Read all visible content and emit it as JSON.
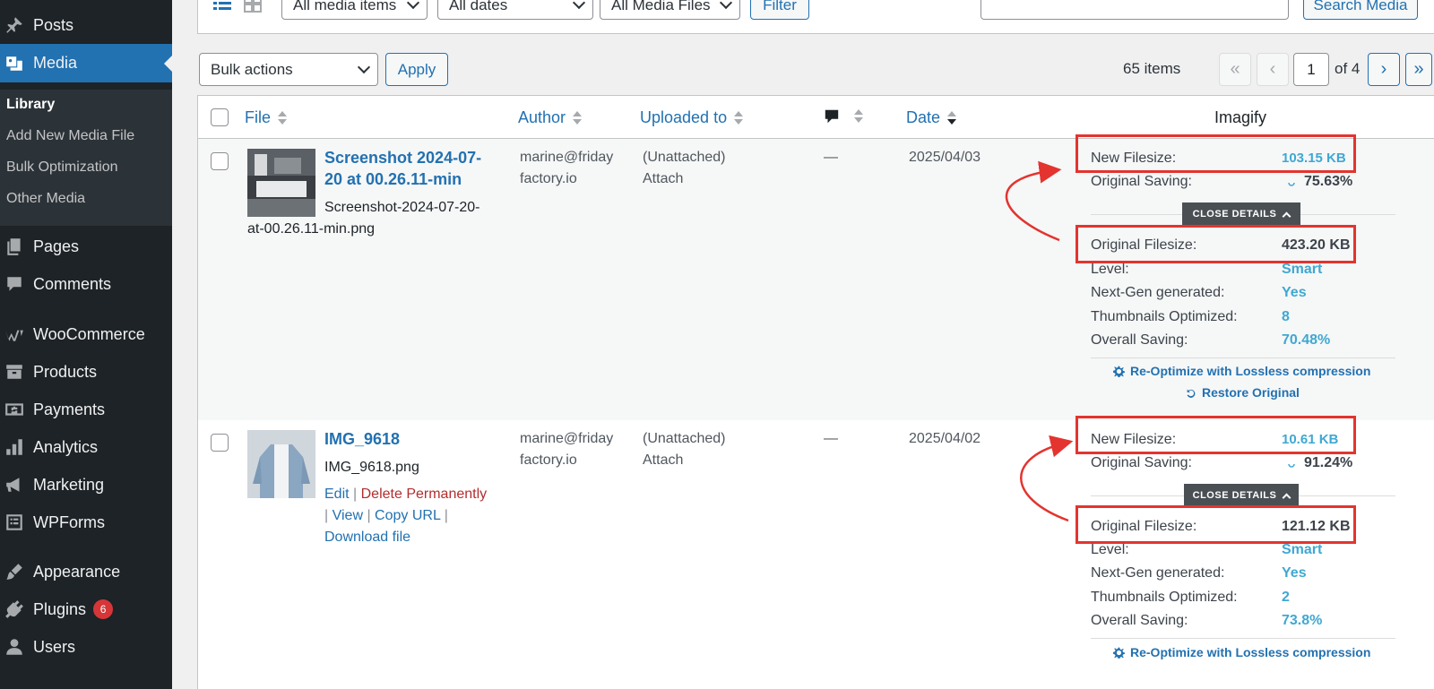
{
  "sidebar": {
    "items": [
      {
        "label": "Posts",
        "icon": "pin-icon"
      },
      {
        "label": "Media",
        "icon": "media-icon",
        "current": true
      },
      {
        "label": "Pages",
        "icon": "pages-icon"
      },
      {
        "label": "Comments",
        "icon": "comment-icon"
      },
      {
        "label": "WooCommerce",
        "icon": "woo-icon"
      },
      {
        "label": "Products",
        "icon": "archive-icon"
      },
      {
        "label": "Payments",
        "icon": "money-icon"
      },
      {
        "label": "Analytics",
        "icon": "chart-icon"
      },
      {
        "label": "Marketing",
        "icon": "megaphone-icon"
      },
      {
        "label": "WPForms",
        "icon": "forms-icon"
      },
      {
        "label": "Appearance",
        "icon": "brush-icon"
      },
      {
        "label": "Plugins",
        "icon": "plug-icon",
        "badge": "6"
      },
      {
        "label": "Users",
        "icon": "user-icon"
      }
    ],
    "submenu": [
      "Library",
      "Add New Media File",
      "Bulk Optimization",
      "Other Media"
    ]
  },
  "filters": {
    "media_type": "All media items",
    "dates": "All dates",
    "media_files": "All Media Files",
    "filter_button": "Filter",
    "search_button": "Search Media"
  },
  "tablenav": {
    "bulk_actions": "Bulk actions",
    "apply": "Apply",
    "items_count": "65 items",
    "first": "«",
    "prev": "‹",
    "current_page": "1",
    "of_pages": "of 4",
    "next": "›",
    "last": "»"
  },
  "columns": {
    "file": "File",
    "author": "Author",
    "uploaded_to": "Uploaded to",
    "date": "Date",
    "imagify": "Imagify"
  },
  "rows": [
    {
      "title_line1": "Screenshot 2024-07-",
      "title_line2": "20 at 00.26.11-min",
      "filename_line1": "Screenshot-2024-07-20-",
      "filename_line2": "at-00.26.11-min.png",
      "author_line1": "marine@friday",
      "author_line2": "factory.io",
      "uploaded": "(Unattached)",
      "attach": "Attach",
      "comments": "—",
      "date": "2025/04/03",
      "imagify": {
        "new_filesize_label": "New Filesize:",
        "new_filesize": "103.15 KB",
        "original_saving_label": "Original Saving:",
        "original_saving": "75.63%",
        "close_details": "CLOSE DETAILS",
        "original_filesize_label": "Original Filesize:",
        "original_filesize": "423.20 KB",
        "level_label": "Level:",
        "level": "Smart",
        "nextgen_label": "Next-Gen generated:",
        "nextgen": "Yes",
        "thumbs_label": "Thumbnails Optimized:",
        "thumbs": "8",
        "overall_label": "Overall Saving:",
        "overall": "70.48%",
        "reoptimize": "Re-Optimize with Lossless compression",
        "restore": "Restore Original"
      }
    },
    {
      "title_line1": "IMG_9618",
      "filename_line1": "IMG_9618.png",
      "actions": {
        "edit": "Edit",
        "delete": "Delete Permanently",
        "view": "View",
        "copy_url": "Copy URL",
        "download": "Download file"
      },
      "author_line1": "marine@friday",
      "author_line2": "factory.io",
      "uploaded": "(Unattached)",
      "attach": "Attach",
      "comments": "—",
      "date": "2025/04/02",
      "imagify": {
        "new_filesize_label": "New Filesize:",
        "new_filesize": "10.61 KB",
        "original_saving_label": "Original Saving:",
        "original_saving": "91.24%",
        "close_details": "CLOSE DETAILS",
        "original_filesize_label": "Original Filesize:",
        "original_filesize": "121.12 KB",
        "level_label": "Level:",
        "level": "Smart",
        "nextgen_label": "Next-Gen generated:",
        "nextgen": "Yes",
        "thumbs_label": "Thumbnails Optimized:",
        "thumbs": "2",
        "overall_label": "Overall Saving:",
        "overall": "73.8%",
        "reoptimize": "Re-Optimize with Lossless compression"
      }
    }
  ],
  "colors": {
    "sidebar_bg": "#1d2327",
    "accent": "#2271b1",
    "imagify_value": "#3fa8d2",
    "highlight_box": "#e3342f"
  }
}
